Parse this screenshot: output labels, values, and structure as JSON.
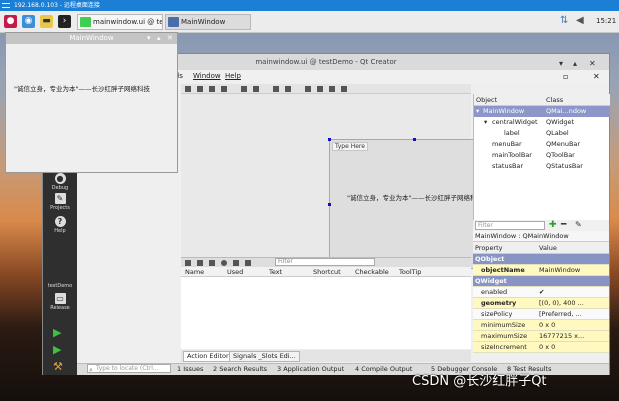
{
  "remote": {
    "title": "192.168.0.103 - 远程桌面连接"
  },
  "taskbar": {
    "tasks": [
      {
        "label": "mainwindow.ui @ tes..."
      },
      {
        "label": "MainWindow"
      }
    ],
    "clock": "15:21"
  },
  "creator": {
    "title": "mainwindow.ui @ testDemo - Qt Creator",
    "menu": {
      "ols": "ols",
      "window": "Window",
      "help": "Help"
    },
    "sidebar": {
      "debug": "Debug",
      "projects": "Projects",
      "help": "Help",
      "project_name": "testDemo",
      "release": "Release"
    },
    "form": {
      "type_here": "Type Here",
      "label_text": "\"诚信立身，专业为本\"——长沙红胖子网络科技"
    },
    "action_editor": {
      "filter_placeholder": "Filter",
      "columns": [
        "Name",
        "Used",
        "Text",
        "Shortcut",
        "Checkable",
        "ToolTip"
      ],
      "tabs": [
        "Action Editor",
        "Signals _Slots Edi..."
      ]
    },
    "object_inspector": {
      "headers": [
        "Object",
        "Class"
      ],
      "rows": [
        {
          "object": "MainWindow",
          "class": "QMai...ndow"
        },
        {
          "object": "centralWidget",
          "class": "QWidget"
        },
        {
          "object": "label",
          "class": "QLabel"
        },
        {
          "object": "menuBar",
          "class": "QMenuBar"
        },
        {
          "object": "mainToolBar",
          "class": "QToolBar"
        },
        {
          "object": "statusBar",
          "class": "QStatusBar"
        }
      ]
    },
    "property_editor": {
      "filter_placeholder": "Filter",
      "class_line": "MainWindow : QMainWindow",
      "headers": [
        "Property",
        "Value"
      ],
      "rows": [
        {
          "key": "QObject",
          "value": "",
          "kind": "grp"
        },
        {
          "key": "objectName",
          "value": "MainWindow",
          "kind": "yel"
        },
        {
          "key": "QWidget",
          "value": "",
          "kind": "grp"
        },
        {
          "key": "enabled",
          "value": "✔",
          "kind": "white"
        },
        {
          "key": "geometry",
          "value": "[(0, 0), 400 ...",
          "kind": "yel"
        },
        {
          "key": "sizePolicy",
          "value": "[Preferred, ...",
          "kind": "white"
        },
        {
          "key": "minimumSize",
          "value": "0 x 0",
          "kind": "yel"
        },
        {
          "key": "maximumSize",
          "value": "16777215 x...",
          "kind": "yel"
        },
        {
          "key": "sizeIncrement",
          "value": "0 x 0",
          "kind": "yel"
        }
      ]
    },
    "bottombar": {
      "locator_placeholder": "Type to locate (Ctrl...",
      "panes": [
        "1 Issues",
        "2 Search Results",
        "3 Application Output",
        "4 Compile Output",
        "5 Debugger Console",
        "8 Test Results"
      ]
    }
  },
  "mainwindow": {
    "title": "MainWindow",
    "text": "\"诚信立身，专业为本\"——长沙红胖子网络科技"
  },
  "watermark": "CSDN @长沙红胖子Qt"
}
